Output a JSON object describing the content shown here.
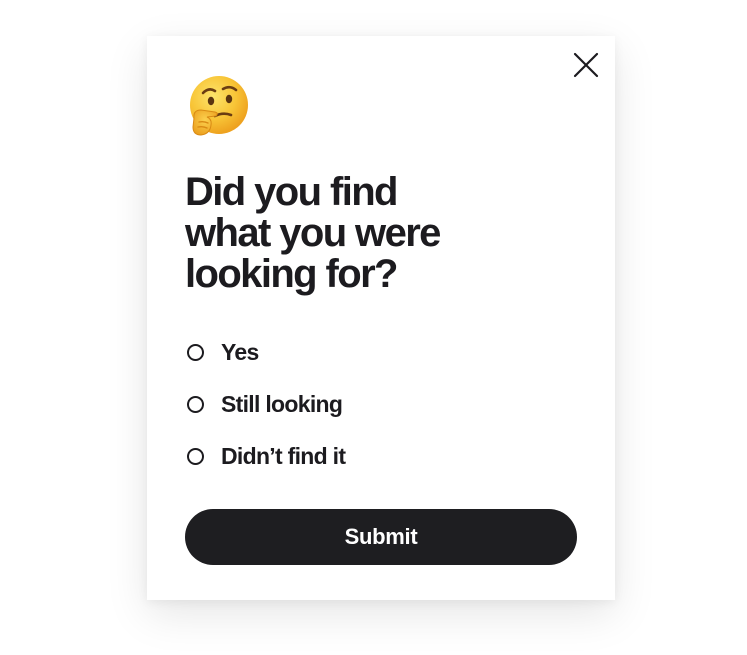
{
  "survey": {
    "emoji_icon": "thinking-face-icon",
    "close_icon": "close-icon",
    "title_lines": [
      "Did you find",
      "what you were",
      "looking for?"
    ],
    "options": [
      {
        "label": "Yes",
        "selected": false
      },
      {
        "label": "Still looking",
        "selected": false
      },
      {
        "label": "Didn’t find it",
        "selected": false
      }
    ],
    "submit_label": "Submit"
  },
  "colors": {
    "text": "#1c1b1f",
    "button_background": "#1e1e21",
    "button_text": "#ffffff",
    "card_background": "#ffffff",
    "emoji_face": "#f7c230"
  }
}
